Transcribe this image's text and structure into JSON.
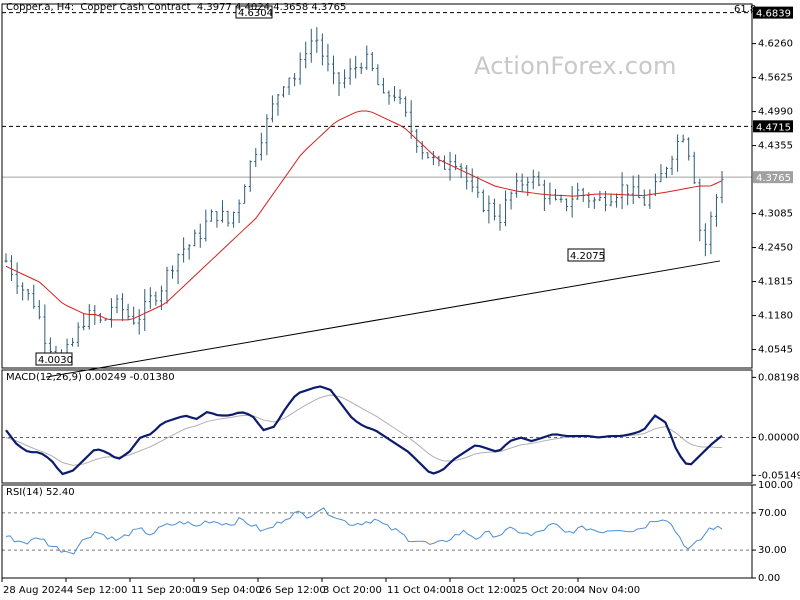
{
  "header": {
    "symbol": "Copper.a, H4:  Copper Cash Contract  4.3977 4.4024 4.3658 4.3765",
    "right_value": "61.8"
  },
  "watermark": "ActionForex.com",
  "panels": {
    "macd_label": "MACD(12,26,9) 0.00249 -0.01380",
    "rsi_label": "RSI(14) 52.40"
  },
  "colors": {
    "candle": "#2e5b74",
    "ma": "#d62020",
    "macd": "#0d1b6e",
    "signal": "#b0b0b0",
    "rsi": "#4a8fd6",
    "grid": "#9a9a9a",
    "axis_tag_bg": "#000000"
  },
  "chart_data": [
    {
      "type": "candlestick",
      "title": "Copper.a, H4: Copper Cash Contract",
      "ylim": [
        4.02,
        4.7
      ],
      "price_ticks": [
        "4.6260",
        "4.5625",
        "4.4990",
        "4.4355",
        "4.3085",
        "4.2450",
        "4.1815",
        "4.1180",
        "4.0545"
      ],
      "x_tick_labels": [
        "28 Aug 2024",
        "4 Sep 12:00",
        "11 Sep 20:00",
        "19 Sep 04:00",
        "26 Sep 12:00",
        "3 Oct 20:00",
        "11 Oct 04:00",
        "18 Oct 12:00",
        "25 Oct 20:00",
        "4 Nov 04:00"
      ],
      "horizontal_levels": [
        {
          "value": 4.6839,
          "label": "4.6839",
          "style": "dashed"
        },
        {
          "value": 4.4715,
          "label": "4.4715",
          "style": "dashed"
        },
        {
          "value": 4.3765,
          "label": "4.3765",
          "style": "solid-grey"
        }
      ],
      "trendline": {
        "from": [
          0,
          4.003
        ],
        "to": [
          1,
          4.22
        ]
      },
      "annotations": [
        {
          "label": "4.6304",
          "price": 4.6304
        },
        {
          "label": "4.2075",
          "price": 4.2075
        },
        {
          "label": "4.0030",
          "price": 4.003
        }
      ],
      "close_path": [
        4.22,
        4.19,
        4.16,
        4.14,
        4.08,
        4.05,
        4.04,
        4.07,
        4.11,
        4.12,
        4.1,
        4.14,
        4.13,
        4.11,
        4.12,
        4.15,
        4.17,
        4.21,
        4.24,
        4.25,
        4.27,
        4.3,
        4.31,
        4.29,
        4.33,
        4.39,
        4.44,
        4.48,
        4.53,
        4.57,
        4.56,
        4.62,
        4.64,
        4.59,
        4.55,
        4.56,
        4.58,
        4.6,
        4.57,
        4.52,
        4.54,
        4.5,
        4.46,
        4.43,
        4.41,
        4.39,
        4.42,
        4.4,
        4.35,
        4.33,
        4.32,
        4.3,
        4.34,
        4.36,
        4.38,
        4.36,
        4.34,
        4.32,
        4.33,
        4.35,
        4.34,
        4.33,
        4.34,
        4.35,
        4.36,
        4.34,
        4.33,
        4.35,
        4.39,
        4.43,
        4.46,
        4.4,
        4.23,
        4.31,
        4.38
      ],
      "moving_average": [
        4.21,
        4.2,
        4.19,
        4.18,
        4.16,
        4.14,
        4.13,
        4.12,
        4.12,
        4.11,
        4.11,
        4.11,
        4.12,
        4.13,
        4.14,
        4.16,
        4.18,
        4.2,
        4.22,
        4.24,
        4.26,
        4.28,
        4.3,
        4.33,
        4.36,
        4.39,
        4.42,
        4.44,
        4.46,
        4.48,
        4.49,
        4.5,
        4.5,
        4.49,
        4.48,
        4.47,
        4.45,
        4.43,
        4.41,
        4.4,
        4.39,
        4.38,
        4.37,
        4.36,
        4.355,
        4.35,
        4.348,
        4.345,
        4.343,
        4.342,
        4.341,
        4.343,
        4.345,
        4.345,
        4.344,
        4.343,
        4.342,
        4.345,
        4.348,
        4.352,
        4.356,
        4.36,
        4.36,
        4.37
      ],
      "xlabel": "",
      "ylabel": ""
    },
    {
      "type": "line",
      "title": "MACD(12,26,9) 0.00249 -0.01380",
      "ylim": [
        -0.062,
        0.092
      ],
      "y_ticks": [
        "0.08198",
        "0.00000",
        "-0.05149"
      ],
      "series": [
        {
          "name": "",
          "values": [
            0.01,
            -0.01,
            -0.02,
            -0.02,
            -0.03,
            -0.05,
            -0.045,
            -0.03,
            -0.015,
            -0.02,
            -0.03,
            -0.02,
            0.0,
            0.005,
            0.02,
            0.025,
            0.03,
            0.025,
            0.035,
            0.03,
            0.03,
            0.035,
            0.03,
            0.01,
            0.015,
            0.04,
            0.06,
            0.065,
            0.07,
            0.065,
            0.045,
            0.025,
            0.015,
            0.01,
            0.0,
            -0.01,
            -0.02,
            -0.035,
            -0.05,
            -0.045,
            -0.03,
            -0.02,
            -0.01,
            -0.015,
            -0.02,
            -0.005,
            0.0,
            -0.005,
            0.0,
            0.005,
            0.002,
            0.002,
            0.002,
            0.0,
            0.002,
            0.002,
            0.005,
            0.01,
            0.03,
            0.02,
            -0.02,
            -0.04,
            -0.025,
            -0.01,
            0.0025
          ]
        },
        {
          "name": "",
          "values": [
            0.0,
            -0.005,
            -0.012,
            -0.018,
            -0.024,
            -0.034,
            -0.038,
            -0.036,
            -0.03,
            -0.026,
            -0.027,
            -0.024,
            -0.018,
            -0.012,
            -0.004,
            0.004,
            0.012,
            0.016,
            0.022,
            0.025,
            0.027,
            0.03,
            0.03,
            0.024,
            0.021,
            0.027,
            0.037,
            0.046,
            0.054,
            0.058,
            0.055,
            0.047,
            0.038,
            0.03,
            0.02,
            0.01,
            0.0,
            -0.012,
            -0.025,
            -0.032,
            -0.032,
            -0.028,
            -0.022,
            -0.02,
            -0.02,
            -0.015,
            -0.01,
            -0.008,
            -0.005,
            -0.002,
            0.0,
            0.001,
            0.001,
            0.001,
            0.001,
            0.002,
            0.003,
            0.005,
            0.012,
            0.015,
            0.005,
            -0.008,
            -0.013,
            -0.013,
            -0.0138
          ]
        }
      ],
      "xlabel": "",
      "ylabel": ""
    },
    {
      "type": "line",
      "title": "RSI(14) 52.40",
      "ylim": [
        0,
        100
      ],
      "y_ticks": [
        "100.00",
        "70.00",
        "30.00",
        "0.00"
      ],
      "levels": [
        70,
        30
      ],
      "series": [
        {
          "name": "",
          "values": [
            45,
            40,
            38,
            44,
            35,
            30,
            28,
            42,
            50,
            45,
            40,
            48,
            52,
            47,
            55,
            58,
            60,
            55,
            62,
            60,
            58,
            63,
            57,
            50,
            56,
            65,
            70,
            67,
            74,
            70,
            62,
            58,
            60,
            63,
            55,
            50,
            42,
            40,
            35,
            38,
            45,
            50,
            43,
            48,
            46,
            52,
            50,
            45,
            52,
            58,
            48,
            52,
            54,
            50,
            52,
            53,
            51,
            55,
            63,
            65,
            48,
            30,
            40,
            55,
            52.4
          ]
        }
      ],
      "xlabel": "",
      "ylabel": ""
    }
  ]
}
